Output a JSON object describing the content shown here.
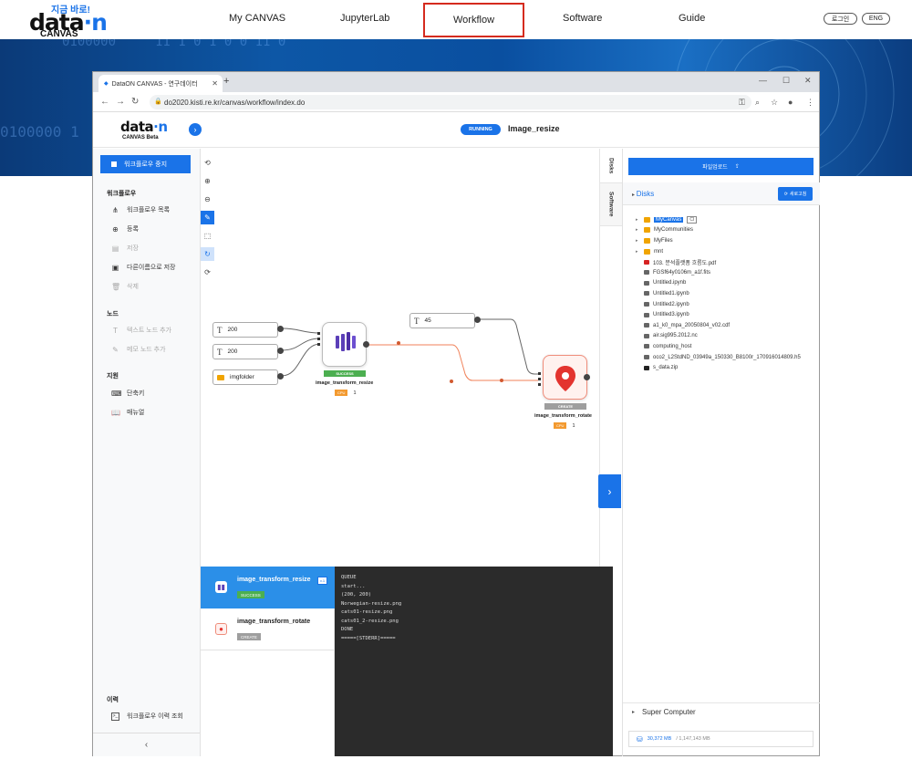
{
  "site": {
    "logo_tag": "지금 바로!",
    "logo_main_a": "data",
    "logo_main_b": "·n",
    "logo_sub": "CANVAS",
    "nav": [
      "My CANVAS",
      "JupyterLab",
      "Workflow",
      "Software",
      "Guide"
    ],
    "active_nav": "Workflow",
    "login": "로그인",
    "lang": "ENG"
  },
  "banner": {
    "bits": [
      "0100000",
      "11 1 0 1 0 0 11 0",
      "0100000 1"
    ]
  },
  "browser": {
    "tab_title": "DataON CANVAS - 연구데이터",
    "url": "do2020.kisti.re.kr/canvas/workflow/index.do"
  },
  "app": {
    "logo_a": "data",
    "logo_b": "·n",
    "logo_sub": "CANVAS Beta",
    "status": "RUNNING",
    "title": "Image_resize"
  },
  "sidebar": {
    "stop_label": "워크플로우 중지",
    "sections": {
      "workflow": "워크플로우",
      "node": "노드",
      "support": "지원",
      "history": "이력"
    },
    "workflow_items": [
      {
        "icon": "tree-icon",
        "label": "워크플로우 목록"
      },
      {
        "icon": "plus-circle-icon",
        "label": "등록"
      },
      {
        "icon": "save-icon",
        "label": "저장"
      },
      {
        "icon": "save-as-icon",
        "label": "다른이름으로 저장"
      },
      {
        "icon": "trash-icon",
        "label": "삭제"
      }
    ],
    "node_items": [
      {
        "icon": "text-icon",
        "label": "텍스트 노드 추가"
      },
      {
        "icon": "memo-icon",
        "label": "메모 노드 추가"
      }
    ],
    "support_items": [
      {
        "icon": "keyboard-icon",
        "label": "단축키"
      },
      {
        "icon": "book-icon",
        "label": "매뉴얼"
      }
    ],
    "history_items": [
      {
        "icon": "terminal-icon",
        "label": "워크플로우 이력 조회"
      }
    ]
  },
  "canvas": {
    "inputs": [
      {
        "type": "text",
        "value": "200"
      },
      {
        "type": "text",
        "value": "200"
      },
      {
        "type": "folder",
        "value": "imgfolder"
      },
      {
        "type": "text",
        "value": "45"
      }
    ],
    "tasks": [
      {
        "name": "image_transform_resize",
        "status": "SUCCESS",
        "cpu": "CPU",
        "count": "1"
      },
      {
        "name": "image_transform_rotate",
        "status": "CREATE",
        "cpu": "CPU",
        "count": "1"
      }
    ],
    "side_tabs": [
      "Disks",
      "Software"
    ]
  },
  "bottom": {
    "tasks": [
      {
        "name": "image_transform_resize",
        "version": "v.1",
        "status": "SUCCESS"
      },
      {
        "name": "image_transform_rotate",
        "version": "",
        "status": "CREATE"
      }
    ],
    "log": [
      "QUEUE",
      "start...",
      "(200, 200)",
      "Norwegian-resize.png",
      "cats01-resize.png",
      "cats01_2-resize.png",
      "DONE",
      "=====[STDERR]====="
    ]
  },
  "right": {
    "upload": "파일업로드",
    "disks": "Disks",
    "refresh": "새로고침",
    "tree": [
      {
        "kind": "folder",
        "name": "MyCanvas",
        "expand": true,
        "selected": true,
        "tag": "CI"
      },
      {
        "kind": "folder",
        "name": "MyCommunities",
        "expand": true
      },
      {
        "kind": "folder",
        "name": "MyFiles",
        "expand": true
      },
      {
        "kind": "folder",
        "name": "mnt",
        "expand": true
      },
      {
        "kind": "pdf",
        "name": "103. 분석플랫폼 흐름도.pdf"
      },
      {
        "kind": "file",
        "name": "FGSf64y0106m_a1f.fits"
      },
      {
        "kind": "file",
        "name": "Untitled.ipynb"
      },
      {
        "kind": "file",
        "name": "Untitled1.ipynb"
      },
      {
        "kind": "file",
        "name": "Untitled2.ipynb"
      },
      {
        "kind": "file",
        "name": "Untitled3.ipynb"
      },
      {
        "kind": "file",
        "name": "a1_k0_mpa_20050804_v02.cdf"
      },
      {
        "kind": "file",
        "name": "air.sig995.2012.nc"
      },
      {
        "kind": "file",
        "name": "computing_host"
      },
      {
        "kind": "file",
        "name": "oco2_L2StdND_03949a_150330_B8100r_170916014809.h5"
      },
      {
        "kind": "zip",
        "name": "s_data.zip"
      }
    ],
    "supercomputer": "Super Computer",
    "storage_used": "30,372 MB",
    "storage_total": "/ 1,147,143 MB"
  }
}
